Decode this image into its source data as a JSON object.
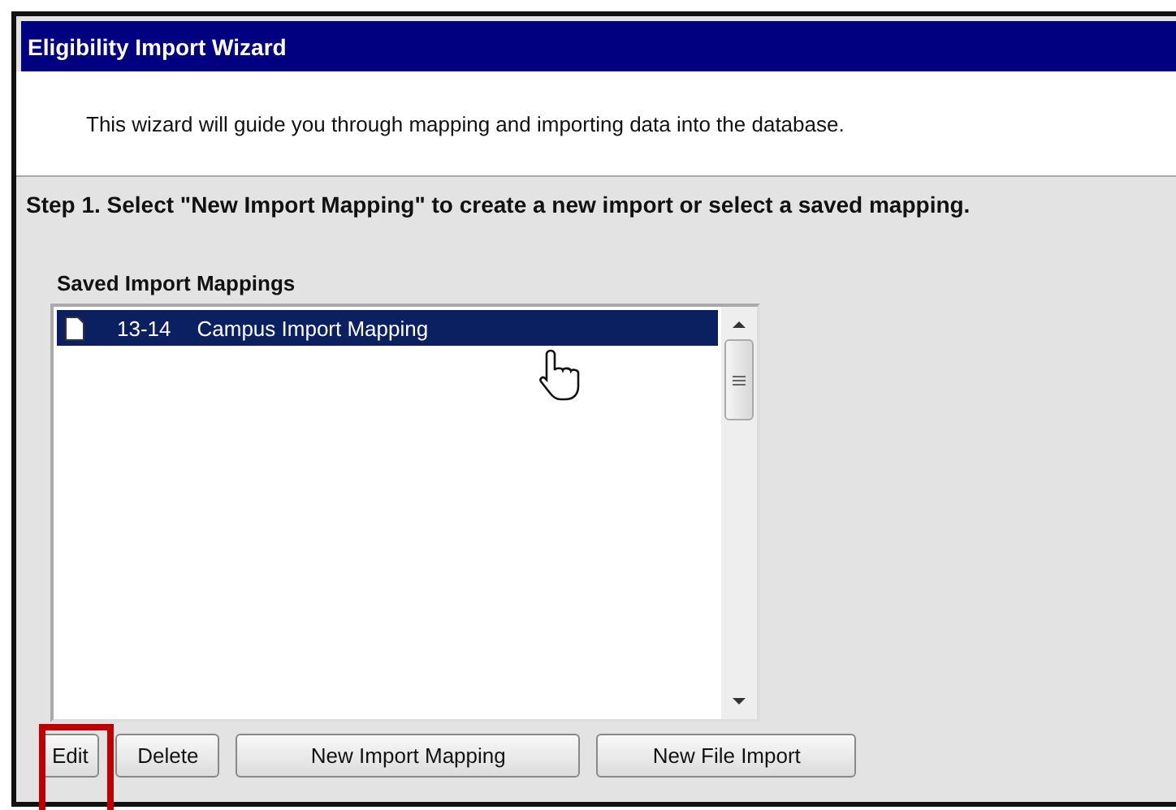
{
  "window": {
    "title": "Eligibility Import Wizard"
  },
  "intro": "This wizard will guide you through mapping and importing data into the database.",
  "step": "Step 1. Select \"New Import Mapping\" to create a new import or select a saved mapping.",
  "mappings": {
    "label": "Saved Import Mappings",
    "items": [
      {
        "year": "13-14",
        "name": "Campus Import Mapping",
        "selected": true
      }
    ]
  },
  "buttons": [
    {
      "label": "Edit",
      "highlighted": true
    },
    {
      "label": "Delete",
      "highlighted": false
    },
    {
      "label": "New Import Mapping",
      "highlighted": false
    },
    {
      "label": "New File Import",
      "highlighted": false
    }
  ]
}
